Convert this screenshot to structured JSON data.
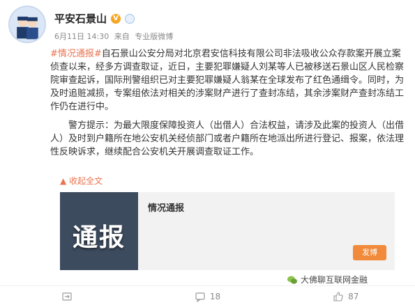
{
  "post": {
    "author": "平安石景山",
    "date": "6月11日 14:30",
    "via_prefix": "来自",
    "via": "专业版微博",
    "hashtag": "#情况通报#",
    "paragraph1": "自石景山公安分局对北京君安信科技有限公司非法吸收公众存款案开展立案侦查以来，经多方调查取证，近日，主要犯罪嫌疑人刘某等人已被移送石景山区人民检察院审查起诉，国际刑警组织已对主要犯罪嫌疑人翁某在全球发布了红色通缉令。同时，为及时追赃减损，专案组依法对相关的涉案财产进行了查封冻结，其余涉案财产查封冻结工作仍在进行中。",
    "paragraph2": "警方提示：为最大限度保障投资人（出借人）合法权益，请涉及此案的投资人（出借人）及时到户籍所在地公安机关经侦部门或者户籍所在地派出所进行登记、报案，依法理性反映诉求，继续配合公安机关开展调查取证工作。",
    "collapse_label": "收起全文"
  },
  "card": {
    "image_text": "通报",
    "title": "情况通报",
    "button_label": "发博"
  },
  "actions": {
    "repost_count": "",
    "comment_count": "18",
    "like_count": "87"
  },
  "watermark": "大佛聊互联网金融",
  "colors": {
    "accent": "#eb7350",
    "button": "#f18a3a"
  }
}
